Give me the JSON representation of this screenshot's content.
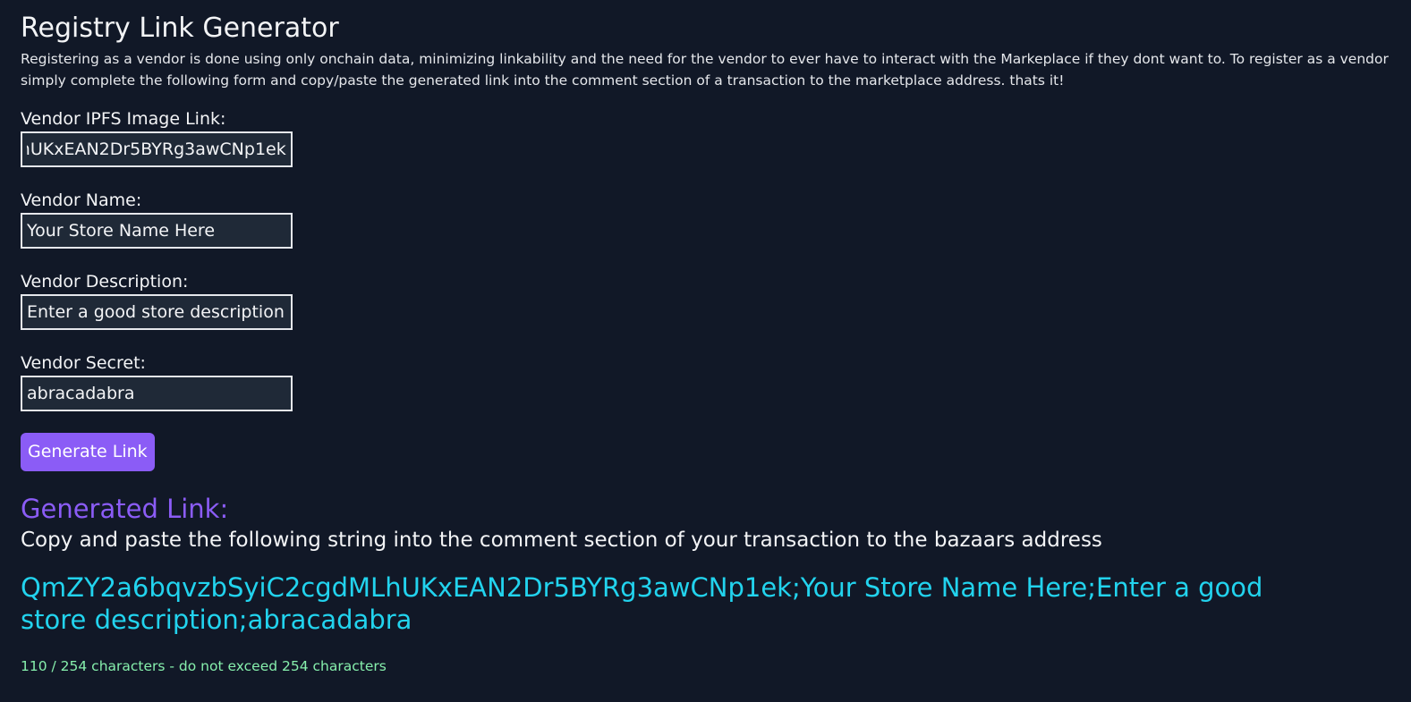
{
  "page": {
    "title": "Registry Link Generator",
    "intro": "Registering as a vendor is done using only onchain data, minimizing linkability and the need for the vendor to ever have to interact with the Markeplace if they dont want to. To register as a vendor simply complete the following form and copy/paste the generated link into the comment section of a transaction to the marketplace address. thats it!"
  },
  "form": {
    "image_label": "Vendor IPFS Image Link:",
    "image_value": "QmZY2a6bqvzbSyiC2cgdMLhUKxEAN2Dr5BYRg3awCNp1ek",
    "name_label": "Vendor Name:",
    "name_value": "Your Store Name Here",
    "description_label": "Vendor Description:",
    "description_value": "Enter a good store description",
    "secret_label": "Vendor Secret:",
    "secret_value": "abracadabra",
    "generate_label": "Generate Link"
  },
  "output": {
    "heading": "Generated Link:",
    "instructions": "Copy and paste the following string into the comment section of your transaction to the bazaars address",
    "link": "QmZY2a6bqvzbSyiC2cgdMLhUKxEAN2Dr5BYRg3awCNp1ek;Your Store Name Here;Enter a good store description;abracadabra",
    "char_count": "110 / 254 characters - do not exceed 254 characters"
  },
  "colors": {
    "background": "#111827",
    "accent": "#8b5cf6",
    "link": "#22d3ee",
    "count": "#86efac"
  }
}
